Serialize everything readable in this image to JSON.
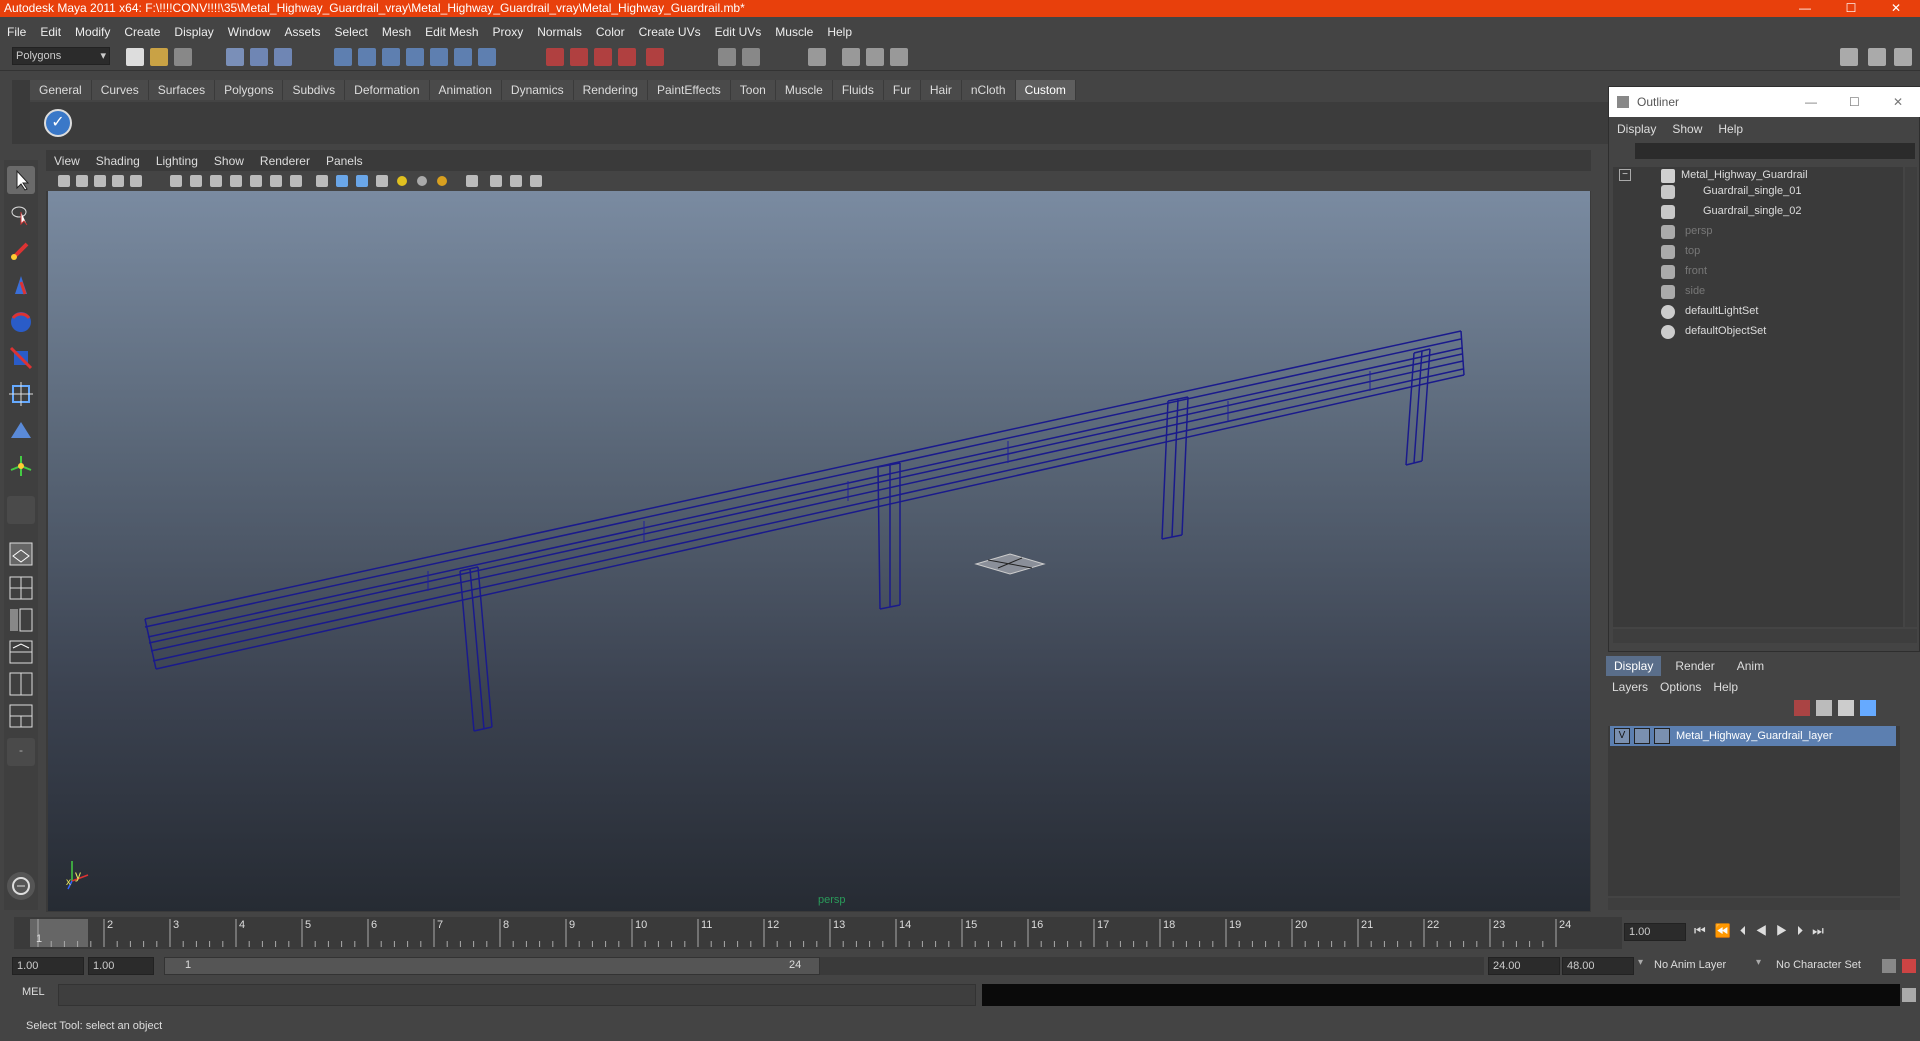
{
  "window": {
    "title": "Autodesk Maya 2011 x64: F:\\!!!!CONV!!!!\\35\\Metal_Highway_Guardrail_vray\\Metal_Highway_Guardrail_vray\\Metal_Highway_Guardrail.mb*"
  },
  "menubar": [
    "File",
    "Edit",
    "Modify",
    "Create",
    "Display",
    "Window",
    "Assets",
    "Select",
    "Mesh",
    "Edit Mesh",
    "Proxy",
    "Normals",
    "Color",
    "Create UVs",
    "Edit UVs",
    "Muscle",
    "Help"
  ],
  "statusline": {
    "mode": "Polygons"
  },
  "shelf": {
    "tabs": [
      "General",
      "Curves",
      "Surfaces",
      "Polygons",
      "Subdivs",
      "Deformation",
      "Animation",
      "Dynamics",
      "Rendering",
      "PaintEffects",
      "Toon",
      "Muscle",
      "Fluids",
      "Fur",
      "Hair",
      "nCloth",
      "Custom"
    ],
    "active": "Custom"
  },
  "viewport": {
    "menu": [
      "View",
      "Shading",
      "Lighting",
      "Show",
      "Renderer",
      "Panels"
    ],
    "camera_label": "persp",
    "axis_y": "y",
    "axis_x": "x"
  },
  "outliner": {
    "title": "Outliner",
    "menu": [
      "Display",
      "Show",
      "Help"
    ],
    "items": [
      {
        "label": "Metal_Highway_Guardrail",
        "dim": false,
        "indent": 0
      },
      {
        "label": "Guardrail_single_01",
        "dim": false,
        "indent": 1
      },
      {
        "label": "Guardrail_single_02",
        "dim": false,
        "indent": 1
      },
      {
        "label": "persp",
        "dim": true,
        "indent": 0
      },
      {
        "label": "top",
        "dim": true,
        "indent": 0
      },
      {
        "label": "front",
        "dim": true,
        "indent": 0
      },
      {
        "label": "side",
        "dim": true,
        "indent": 0
      },
      {
        "label": "defaultLightSet",
        "dim": false,
        "indent": 0
      },
      {
        "label": "defaultObjectSet",
        "dim": false,
        "indent": 0
      }
    ]
  },
  "layers": {
    "tabs": [
      "Display",
      "Render",
      "Anim"
    ],
    "active_tab": "Display",
    "menu": [
      "Layers",
      "Options",
      "Help"
    ],
    "layer_name": "Metal_Highway_Guardrail_layer",
    "visibility": "V"
  },
  "timeline": {
    "ticks": [
      "1",
      "2",
      "3",
      "4",
      "5",
      "6",
      "7",
      "8",
      "9",
      "10",
      "11",
      "12",
      "13",
      "14",
      "15",
      "16",
      "17",
      "18",
      "19",
      "20",
      "21",
      "22",
      "23",
      "24"
    ],
    "current_frame": "1.00",
    "playhead": "1"
  },
  "range": {
    "start": "1.00",
    "start2": "1.00",
    "slider_start": "1",
    "slider_end": "24",
    "end": "24.00",
    "end2": "48.00",
    "anim_layer": "No Anim Layer",
    "char_set": "No Character Set"
  },
  "cmd": {
    "label": "MEL"
  },
  "help": {
    "text": "Select Tool: select an object"
  }
}
